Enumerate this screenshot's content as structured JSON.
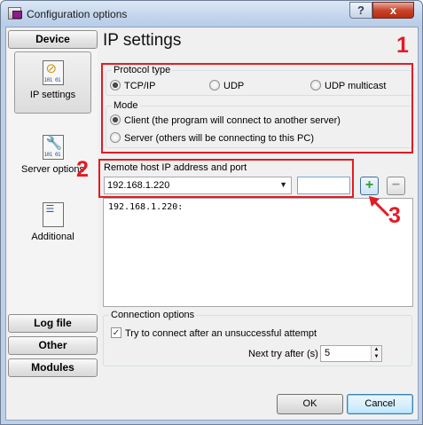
{
  "window": {
    "title": "Configuration options",
    "help_glyph": "?",
    "close_glyph": "x"
  },
  "sidebar": {
    "top_button": "Device",
    "items": [
      {
        "label": "IP settings",
        "icon": "ip-settings-icon",
        "active": true
      },
      {
        "label": "Server options",
        "icon": "wrench-icon",
        "active": false
      },
      {
        "label": "Additional",
        "icon": "list-icon",
        "active": false
      }
    ],
    "bottom_buttons": [
      "Log file",
      "Other",
      "Modules"
    ]
  },
  "main": {
    "title": "IP settings",
    "protocol": {
      "legend": "Protocol type",
      "options": [
        "TCP/IP",
        "UDP",
        "UDP multicast"
      ],
      "selected": "TCP/IP"
    },
    "mode": {
      "legend": "Mode",
      "options": [
        "Client (the program will connect to another server)",
        "Server (others will be connecting to this PC)"
      ],
      "selected": 0
    },
    "remote_host": {
      "legend": "Remote host IP address and port",
      "ip_value": "192.168.1.220",
      "port_value": "",
      "add_glyph": "+",
      "remove_glyph": "−"
    },
    "log_text": "192.168.1.220:",
    "connection": {
      "legend": "Connection options",
      "retry_label": "Try to connect after an unsuccessful attempt",
      "retry_checked": true,
      "next_try_label": "Next try after (s)",
      "next_try_value": "5"
    }
  },
  "annotations": {
    "marker1": "1",
    "marker2": "2",
    "marker3": "3",
    "color": "#e41b23"
  },
  "footer": {
    "ok_label": "OK",
    "cancel_label": "Cancel"
  }
}
